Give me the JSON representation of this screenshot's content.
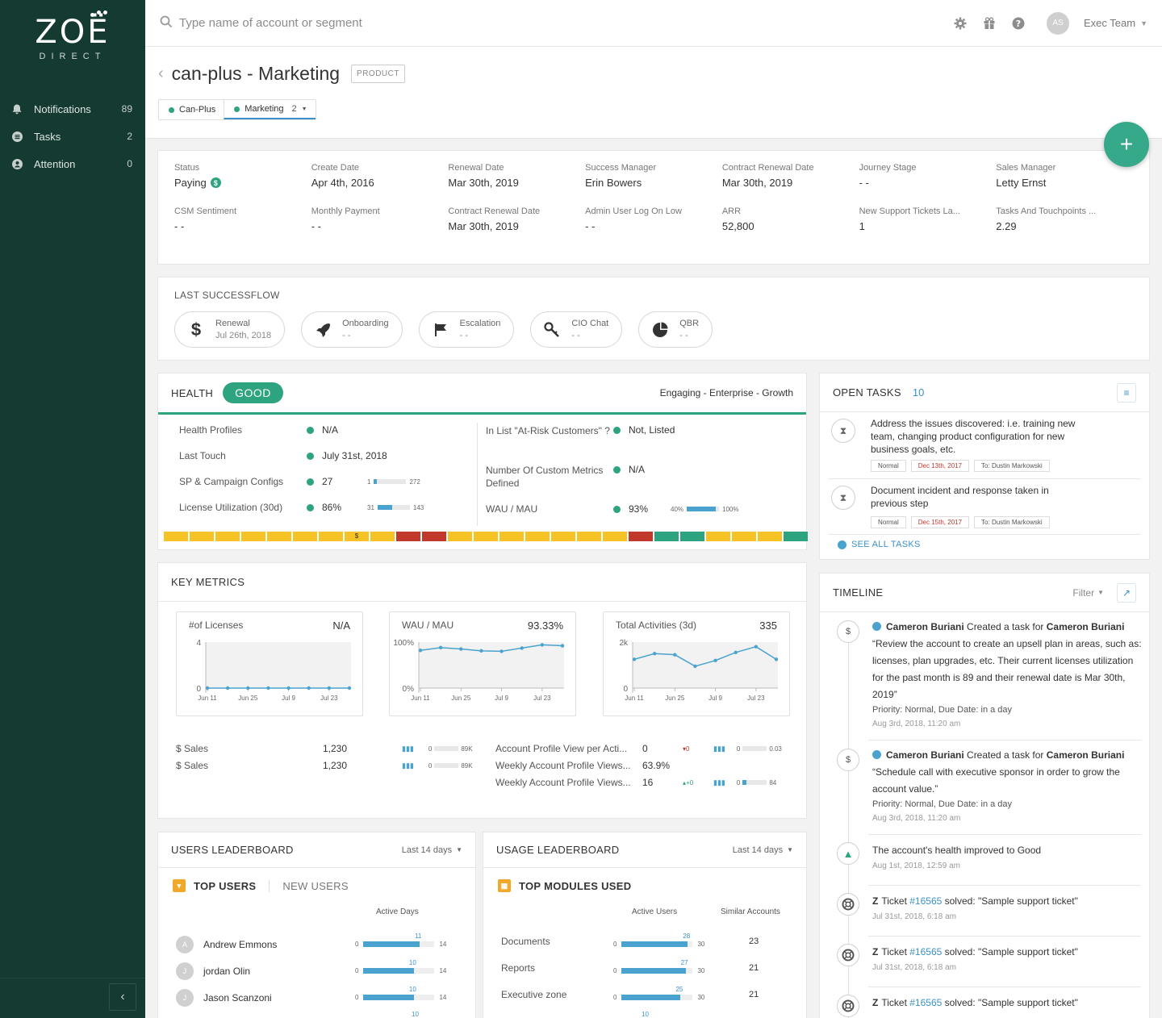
{
  "sidebar": {
    "logo_mark": "ZOË",
    "logo_sub": "DIRECT",
    "items": [
      {
        "label": "Notifications",
        "count": "89"
      },
      {
        "label": "Tasks",
        "count": "2"
      },
      {
        "label": "Attention",
        "count": "0"
      }
    ],
    "collapse_icon": "chevron-left-icon"
  },
  "topbar": {
    "search_placeholder": "Type name of account or segment",
    "avatar_initials": "AS",
    "user_name": "Exec Team"
  },
  "header": {
    "title": "can-plus - Marketing",
    "tag": "PRODUCT",
    "crumbs": [
      {
        "label": "Can-Plus",
        "count": ""
      },
      {
        "label": "Marketing",
        "count": "2"
      }
    ],
    "fab": "+"
  },
  "info": {
    "fields": [
      {
        "label": "Status",
        "value": "Paying"
      },
      {
        "label": "Create Date",
        "value": "Apr 4th, 2016"
      },
      {
        "label": "Renewal Date",
        "value": "Mar 30th, 2019"
      },
      {
        "label": "Success Manager",
        "value": "Erin Bowers"
      },
      {
        "label": "Contract Renewal Date",
        "value": "Mar 30th, 2019"
      },
      {
        "label": "Journey Stage",
        "value": "- -"
      },
      {
        "label": "Sales Manager",
        "value": "Letty Ernst"
      },
      {
        "label": "CSM Sentiment",
        "value": "- -"
      },
      {
        "label": "Monthly Payment",
        "value": "- -"
      },
      {
        "label": "Contract Renewal Date",
        "value": "Mar 30th, 2019"
      },
      {
        "label": "Admin User Log On Low",
        "value": "- -"
      },
      {
        "label": "ARR",
        "value": "52,800"
      },
      {
        "label": "New Support Tickets La...",
        "value": "1"
      },
      {
        "label": "Tasks And Touchpoints ...",
        "value": "2.29"
      }
    ],
    "paying_icon": "$"
  },
  "successflow": {
    "title": "LAST SUCCESSFLOW",
    "items": [
      {
        "label": "Renewal",
        "date": "Jul 26th, 2018",
        "icon": "dollar-icon"
      },
      {
        "label": "Onboarding",
        "date": "- -",
        "icon": "rocket-icon"
      },
      {
        "label": "Escalation",
        "date": "- -",
        "icon": "flag-icon"
      },
      {
        "label": "CIO Chat",
        "date": "- -",
        "icon": "key-icon"
      },
      {
        "label": "QBR",
        "date": "- -",
        "icon": "pie-icon"
      }
    ]
  },
  "health": {
    "title": "HEALTH",
    "badge": "GOOD",
    "segment": "Engaging - Enterprise - Growth",
    "left": [
      {
        "label": "Health Profiles",
        "value": "N/A"
      },
      {
        "label": "Last Touch",
        "value": "July 31st, 2018"
      },
      {
        "label": "SP & Campaign Configs",
        "value": "27",
        "min": "1",
        "max": "272",
        "fill": 0.1
      },
      {
        "label": "License Utilization (30d)",
        "value": "86%",
        "min": "31",
        "max": "143",
        "fill": 0.45
      }
    ],
    "right": [
      {
        "label": "In List \"At-Risk Customers\" ?",
        "value": "Not, Listed"
      },
      {
        "label": "Number Of Custom Metrics Defined",
        "value": "N/A"
      },
      {
        "label": "WAU / MAU",
        "value": "93%",
        "min": "40%",
        "max": "100%",
        "fill": 0.9
      }
    ],
    "strip": [
      "y",
      "y",
      "y",
      "y",
      "y",
      "y",
      "y",
      "y$",
      "y",
      "r",
      "r",
      "y",
      "y",
      "y",
      "y",
      "y",
      "y",
      "y",
      "r",
      "g",
      "g",
      "y",
      "y",
      "y",
      "g"
    ],
    "strip_marker": "$",
    "colors": {
      "y": "#f5c326",
      "r": "#c0392b",
      "g": "#2ea37f"
    }
  },
  "key_metrics": {
    "title": "KEY METRICS",
    "charts": [
      {
        "title": "#of Licenses",
        "value": "N/A",
        "ymax": "4",
        "ymin": "0",
        "xticks": [
          "Jun 11",
          "Jun 25",
          "Jul 9",
          "Jul 23"
        ],
        "points": [
          0,
          0,
          0,
          0,
          0,
          0,
          0,
          0
        ],
        "pmax": 4
      },
      {
        "title": "WAU / MAU",
        "value": "93.33%",
        "ymax": "100%",
        "ymin": "0%",
        "xticks": [
          "Jun 11",
          "Jun 25",
          "Jul 9",
          "Jul 23"
        ],
        "points": [
          82,
          88,
          85,
          81,
          80,
          87,
          94,
          92
        ],
        "pmax": 100
      },
      {
        "title": "Total Activities (3d)",
        "value": "335",
        "ymax": "2k",
        "ymin": "0",
        "xticks": [
          "Jun 11",
          "Jun 25",
          "Jul 9",
          "Jul 23"
        ],
        "points": [
          1250,
          1500,
          1450,
          950,
          1200,
          1550,
          1800,
          1250
        ],
        "pmax": 2000
      }
    ],
    "rows_left": [
      {
        "name": "$ Sales",
        "value": "1,230",
        "min": "0",
        "max": "89K"
      },
      {
        "name": "$ Sales",
        "value": "1,230",
        "min": "0",
        "max": "89K"
      }
    ],
    "rows_right": [
      {
        "name": "Account Profile View per Acti...",
        "value": "0",
        "delta": "▾0",
        "min": "0",
        "max": "0.03",
        "fill": 0
      },
      {
        "name": "Weekly Account Profile Views...",
        "value": "63.9%",
        "delta": "",
        "min": "",
        "max": "",
        "fill": 0
      },
      {
        "name": "Weekly Account Profile Views...",
        "value": "16",
        "delta": "▴+0",
        "min": "0",
        "max": "84",
        "fill": 0.15
      }
    ]
  },
  "users_leaderboard": {
    "title": "USERS LEADERBOARD",
    "range": "Last 14 days",
    "tab_on": "TOP USERS",
    "tab_off": "NEW USERS",
    "col": "Active Days",
    "rows": [
      {
        "initial": "A",
        "name": "Andrew Emmons",
        "min": "0",
        "max": "14",
        "val": "11",
        "fill": 0.79
      },
      {
        "initial": "J",
        "name": "jordan Olin",
        "min": "0",
        "max": "14",
        "val": "10",
        "fill": 0.71
      },
      {
        "initial": "J",
        "name": "Jason Scanzoni",
        "min": "0",
        "max": "14",
        "val": "10",
        "fill": 0.71
      }
    ],
    "next_val": "10"
  },
  "usage_leaderboard": {
    "title": "USAGE LEADERBOARD",
    "range": "Last 14 days",
    "tab_on": "TOP MODULES USED",
    "col1": "Active Users",
    "col2": "Similar Accounts",
    "rows": [
      {
        "name": "Documents",
        "min": "0",
        "max": "30",
        "val": "28",
        "fill": 0.93,
        "similar": "23"
      },
      {
        "name": "Reports",
        "min": "0",
        "max": "30",
        "val": "27",
        "fill": 0.9,
        "similar": "21"
      },
      {
        "name": "Executive zone",
        "min": "0",
        "max": "30",
        "val": "25",
        "fill": 0.83,
        "similar": "21"
      }
    ],
    "next_val": "10"
  },
  "open_tasks": {
    "title": "OPEN TASKS",
    "count": "10",
    "tasks": [
      {
        "text": "Address the issues discovered: i.e. training new team, changing product configuration for new business goals, etc.",
        "priority": "Normal",
        "date": "Dec 13th, 2017",
        "to": "To: Dustin Markowski"
      },
      {
        "text": "Document incident and response taken in previous step",
        "priority": "Normal",
        "date": "Dec 15th, 2017",
        "to": "To: Dustin Markowski"
      }
    ],
    "see_all": "SEE ALL TASKS"
  },
  "timeline": {
    "title": "TIMELINE",
    "filter": "Filter",
    "items": [
      {
        "actor": "Cameron Buriani",
        "action": " Created a task for ",
        "target": "Cameron Buriani",
        "body": "“Review the account to create an upsell plan in areas, such as: licenses, plan upgrades, etc. Their current licenses utilization for the past month is 89 and their renewal date is Mar 30th, 2019”",
        "meta_k1": "Priority: ",
        "meta_v1": "Normal",
        "meta_k2": ", Due Date: ",
        "meta_v2": "in a day",
        "time": "Aug 3rd, 2018, 11:20 am"
      },
      {
        "actor": "Cameron Buriani",
        "action": " Created a task for ",
        "target": "Cameron Buriani",
        "body": "“Schedule call with executive sponsor in order to grow the account value.”",
        "meta_k1": "Priority: ",
        "meta_v1": "Normal",
        "meta_k2": ", Due Date: ",
        "meta_v2": "in a day",
        "time": "Aug 3rd, 2018, 11:20 am"
      }
    ],
    "health_event": {
      "text": "The account's health improved to Good",
      "time": "Aug 1st, 2018, 12:59 am"
    },
    "tickets": [
      {
        "pre": "Ticket ",
        "id": "#16565",
        "post": " solved: \"Sample support ticket\"",
        "time": "Jul 31st, 2018, 6:18 am"
      },
      {
        "pre": "Ticket ",
        "id": "#16565",
        "post": " solved: \"Sample support ticket\"",
        "time": "Jul 31st, 2018, 6:18 am"
      },
      {
        "pre": "Ticket ",
        "id": "#16565",
        "post": " solved: \"Sample support ticket\"",
        "time": ""
      }
    ]
  }
}
